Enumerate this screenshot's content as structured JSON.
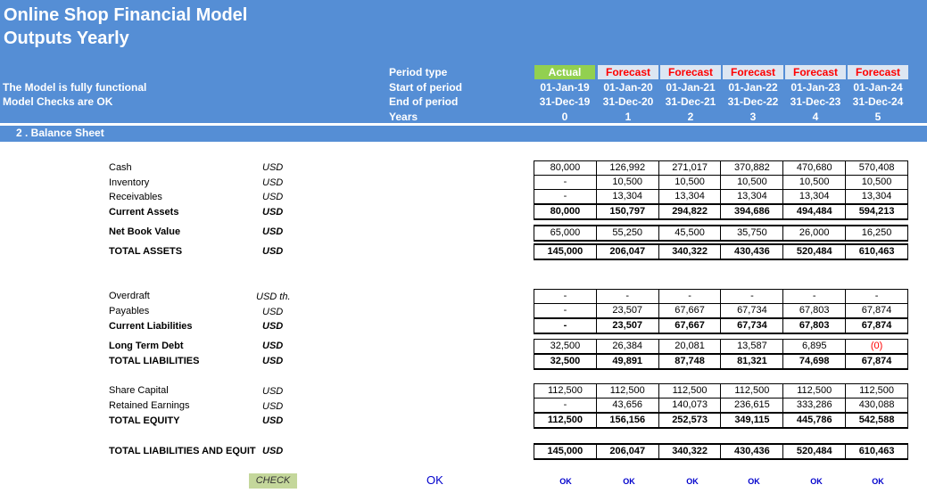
{
  "header": {
    "title_line1": "Online Shop Financial Model",
    "title_line2": "Outputs Yearly",
    "status1": "The Model is fully functional",
    "status2": "Model Checks are OK",
    "row_labels": {
      "period_type": "Period type",
      "start": "Start of period",
      "end": "End of period",
      "years": "Years"
    },
    "periods": [
      {
        "type": "Actual",
        "start": "01-Jan-19",
        "end": "31-Dec-19",
        "year": "0"
      },
      {
        "type": "Forecast",
        "start": "01-Jan-20",
        "end": "31-Dec-20",
        "year": "1"
      },
      {
        "type": "Forecast",
        "start": "01-Jan-21",
        "end": "31-Dec-21",
        "year": "2"
      },
      {
        "type": "Forecast",
        "start": "01-Jan-22",
        "end": "31-Dec-22",
        "year": "3"
      },
      {
        "type": "Forecast",
        "start": "01-Jan-23",
        "end": "31-Dec-23",
        "year": "4"
      },
      {
        "type": "Forecast",
        "start": "01-Jan-24",
        "end": "31-Dec-24",
        "year": "5"
      }
    ],
    "colors": {
      "banner": "#558ED5",
      "actual": "#92D050",
      "forecast_bg": "#DCE6F2",
      "forecast_text": "#FF0000"
    }
  },
  "section": {
    "title": "2 . Balance Sheet"
  },
  "rows": {
    "cash": {
      "label": "Cash",
      "unit": "USD",
      "values": [
        "80,000",
        "126,992",
        "271,017",
        "370,882",
        "470,680",
        "570,408"
      ]
    },
    "inventory": {
      "label": "Inventory",
      "unit": "USD",
      "values": [
        "-",
        "10,500",
        "10,500",
        "10,500",
        "10,500",
        "10,500"
      ]
    },
    "receivables": {
      "label": "Receivables",
      "unit": "USD",
      "values": [
        "-",
        "13,304",
        "13,304",
        "13,304",
        "13,304",
        "13,304"
      ]
    },
    "current_assets": {
      "label": "Current Assets",
      "unit": "USD",
      "values": [
        "80,000",
        "150,797",
        "294,822",
        "394,686",
        "494,484",
        "594,213"
      ]
    },
    "nbv": {
      "label": "Net Book Value",
      "unit": "USD",
      "values": [
        "65,000",
        "55,250",
        "45,500",
        "35,750",
        "26,000",
        "16,250"
      ]
    },
    "total_assets": {
      "label": "TOTAL ASSETS",
      "unit": "USD",
      "values": [
        "145,000",
        "206,047",
        "340,322",
        "430,436",
        "520,484",
        "610,463"
      ]
    },
    "overdraft": {
      "label": "Overdraft",
      "unit": "USD th.",
      "values": [
        "-",
        "-",
        "-",
        "-",
        "-",
        "-"
      ]
    },
    "payables": {
      "label": "Payables",
      "unit": "USD",
      "values": [
        "-",
        "23,507",
        "67,667",
        "67,734",
        "67,803",
        "67,874"
      ]
    },
    "current_liabilities": {
      "label": "Current Liabilities",
      "unit": "USD",
      "values": [
        "-",
        "23,507",
        "67,667",
        "67,734",
        "67,803",
        "67,874"
      ]
    },
    "ltd": {
      "label": "Long Term Debt",
      "unit": "USD",
      "values": [
        "32,500",
        "26,384",
        "20,081",
        "13,587",
        "6,895",
        "(0)"
      ]
    },
    "total_liabilities": {
      "label": "TOTAL LIABILITIES",
      "unit": "USD",
      "values": [
        "32,500",
        "49,891",
        "87,748",
        "81,321",
        "74,698",
        "67,874"
      ]
    },
    "share_capital": {
      "label": "Share Capital",
      "unit": "USD",
      "values": [
        "112,500",
        "112,500",
        "112,500",
        "112,500",
        "112,500",
        "112,500"
      ]
    },
    "retained": {
      "label": "Retained Earnings",
      "unit": "USD",
      "values": [
        "-",
        "43,656",
        "140,073",
        "236,615",
        "333,286",
        "430,088"
      ]
    },
    "total_equity": {
      "label": "TOTAL EQUITY",
      "unit": "USD",
      "values": [
        "112,500",
        "156,156",
        "252,573",
        "349,115",
        "445,786",
        "542,588"
      ]
    },
    "total_le": {
      "label": "TOTAL LIABILITIES AND EQUIT",
      "unit": "USD",
      "values": [
        "145,000",
        "206,047",
        "340,322",
        "430,436",
        "520,484",
        "610,463"
      ]
    }
  },
  "check": {
    "label": "CHECK",
    "overall": "OK",
    "values": [
      "OK",
      "OK",
      "OK",
      "OK",
      "OK",
      "OK"
    ]
  }
}
